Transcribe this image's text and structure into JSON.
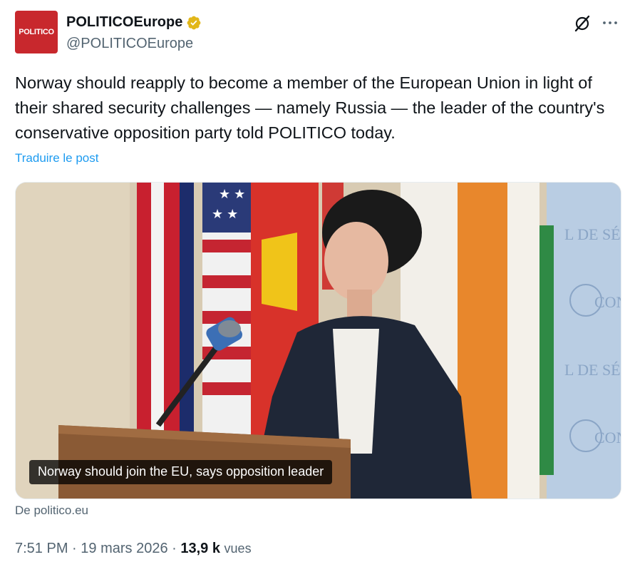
{
  "author": {
    "avatar_text": "POLITICO",
    "display_name": "POLITICOEurope",
    "handle": "@POLITICOEurope",
    "verified_color": "#e2b719"
  },
  "header_icons": [
    "grok-icon",
    "more-icon"
  ],
  "tweet": {
    "text": "Norway should reapply to become a member of the European Union in light of their shared security challenges — namely Russia — the leader of the country's conservative opposition party told POLITICO today.",
    "translate_label": "Traduire le post"
  },
  "card": {
    "caption": "Norway should join the EU, says opposition leader",
    "source": "De politico.eu"
  },
  "meta": {
    "time": "7:51 PM",
    "separator": "·",
    "date": "19 mars 2026",
    "views_count": "13,9 k",
    "views_label": "vues"
  },
  "colors": {
    "link": "#1d9bf0",
    "secondary_text": "#536471",
    "primary_text": "#0f1419",
    "brand_red": "#c8282d"
  }
}
